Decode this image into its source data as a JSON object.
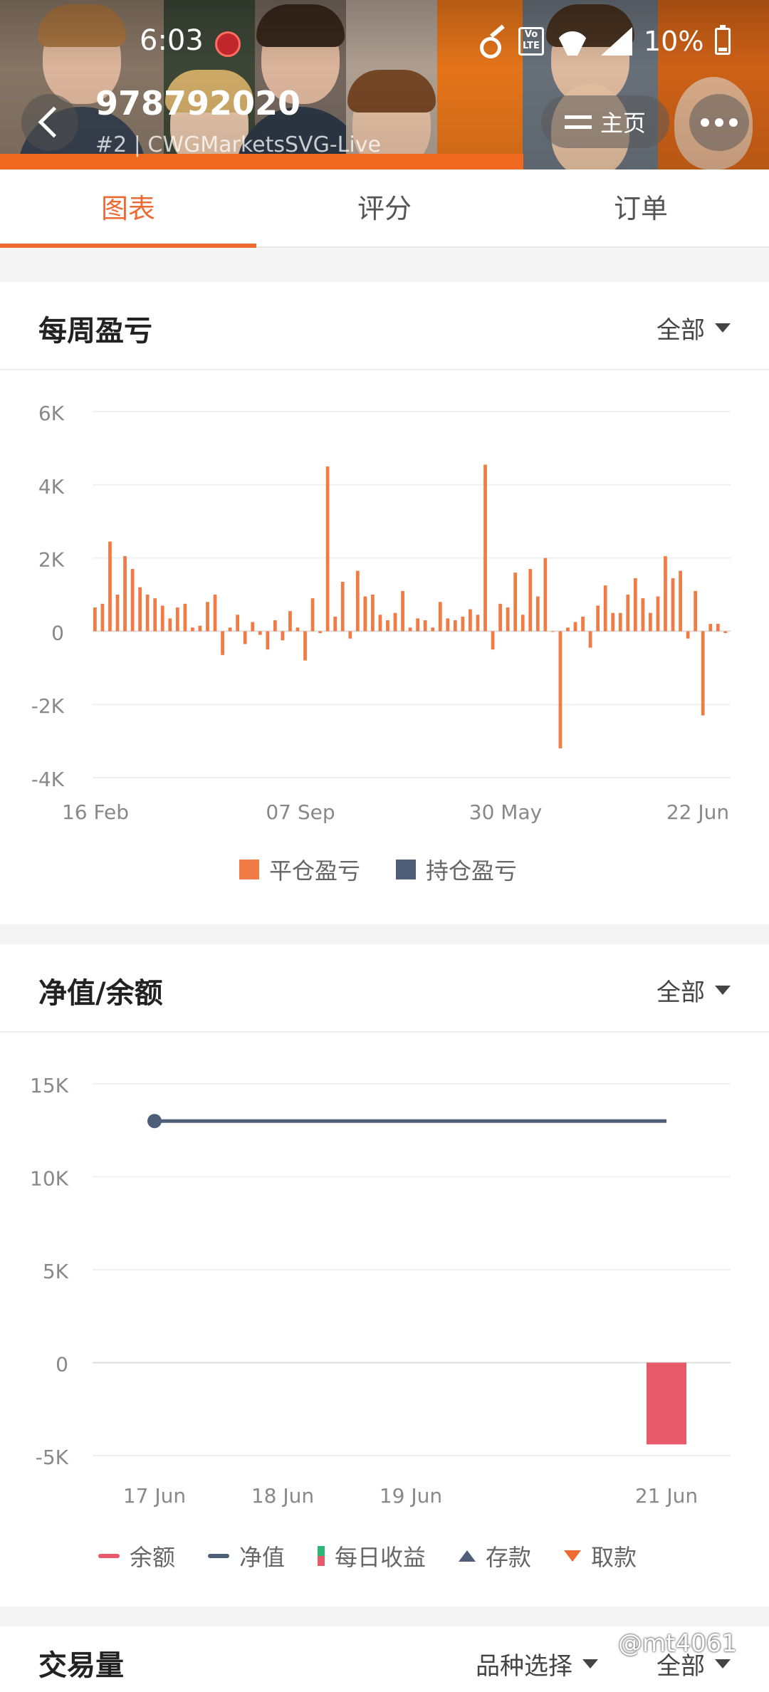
{
  "status_bar": {
    "time": "6:03",
    "battery": "10%",
    "icons": [
      "key-icon",
      "volte-icon",
      "wifi-icon",
      "signal-4g-icon",
      "battery-icon"
    ],
    "volte_text": "Vo LTE"
  },
  "header": {
    "account_id": "978792020",
    "subtitle": "#2 | CWGMarketsSVG-Live",
    "home_label": "主页"
  },
  "tabs": [
    {
      "label": "图表",
      "active": true
    },
    {
      "label": "评分",
      "active": false
    },
    {
      "label": "订单",
      "active": false
    }
  ],
  "weekly_pnl": {
    "title": "每周盈亏",
    "filter": "全部",
    "legend": [
      {
        "label": "平仓盈亏",
        "color": "#f07b45"
      },
      {
        "label": "持仓盈亏",
        "color": "#4e5d78"
      }
    ]
  },
  "equity_balance": {
    "title": "净值/余额",
    "filter": "全部",
    "legend": [
      {
        "label": "余额",
        "color": "#e85a6a"
      },
      {
        "label": "净值",
        "color": "#4e5d78"
      },
      {
        "label": "每日收益",
        "color": "#2bb673"
      },
      {
        "label": "存款",
        "color": "#4e5d78"
      },
      {
        "label": "取款",
        "color": "#ef6a33"
      }
    ]
  },
  "volume": {
    "title": "交易量",
    "symbol_filter": "品种选择",
    "filter": "全部"
  },
  "watermark": "@mt4061",
  "chart_data": [
    {
      "type": "bar",
      "yticks": [
        "6K",
        "4K",
        "2K",
        "0",
        "-2K",
        "-4K"
      ],
      "ylim": [
        -4000,
        6000
      ],
      "xticks": [
        "16 Feb",
        "07 Sep",
        "30 May",
        "22 Jun"
      ],
      "series": [
        {
          "name": "平仓盈亏",
          "values": [
            650,
            750,
            2450,
            1000,
            2050,
            1700,
            1200,
            1000,
            900,
            700,
            350,
            650,
            750,
            100,
            150,
            800,
            1000,
            -650,
            100,
            450,
            -350,
            250,
            -100,
            -500,
            300,
            -250,
            550,
            100,
            -800,
            900,
            -50,
            4500,
            400,
            1350,
            -200,
            1650,
            950,
            1000,
            450,
            300,
            500,
            1100,
            100,
            350,
            300,
            100,
            800,
            350,
            300,
            400,
            600,
            450,
            4550,
            -500,
            750,
            650,
            1600,
            450,
            1700,
            950,
            2000,
            0,
            -3200,
            100,
            250,
            400,
            -450,
            700,
            1250,
            500,
            500,
            1000,
            1450,
            900,
            500,
            950,
            2050,
            1450,
            1650,
            -200,
            1100,
            -2300,
            200,
            200,
            -50
          ]
        },
        {
          "name": "持仓盈亏",
          "values": []
        }
      ]
    },
    {
      "type": "line",
      "yticks": [
        "15K",
        "10K",
        "5K",
        "0",
        "-5K"
      ],
      "ylim": [
        -5000,
        15000
      ],
      "xticks": [
        "17 Jun",
        "18 Jun",
        "19 Jun",
        "21 Jun"
      ],
      "series": [
        {
          "name": "净值",
          "type": "line",
          "x": [
            "17 Jun",
            "21 Jun"
          ],
          "values": [
            13000,
            13000
          ]
        },
        {
          "name": "余额",
          "type": "bar",
          "x": [
            "21 Jun"
          ],
          "values": [
            -4400
          ]
        }
      ]
    }
  ]
}
